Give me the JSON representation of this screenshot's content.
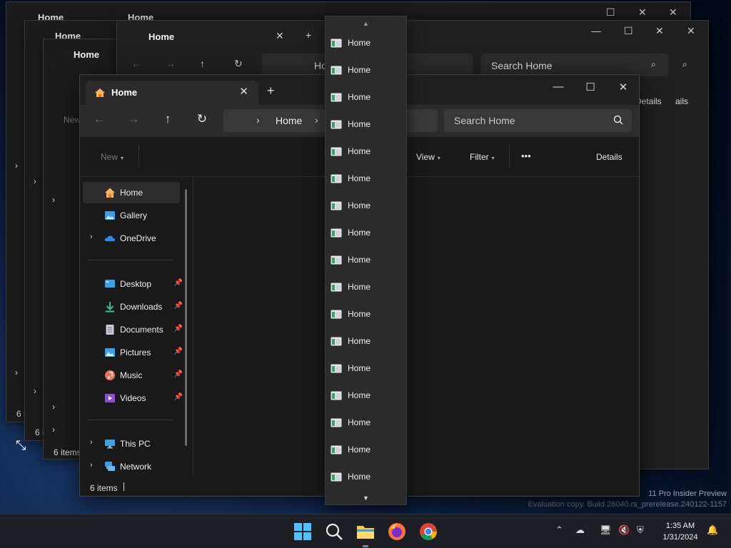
{
  "window": {
    "tab_title": "Home",
    "new_tab": "+",
    "controls": {
      "minimize": "—",
      "maximize": "☐",
      "close": "✕"
    }
  },
  "address": {
    "crumb": "Home",
    "search_placeholder": "Search Home"
  },
  "toolbar": {
    "new": "New",
    "view": "View",
    "filter": "Filter",
    "more": "•••",
    "details": "Details"
  },
  "sidebar": {
    "top": [
      {
        "label": "Home",
        "icon": "home-icon",
        "selected": true
      },
      {
        "label": "Gallery",
        "icon": "gallery-icon"
      },
      {
        "label": "OneDrive",
        "icon": "onedrive-icon",
        "expandable": true
      }
    ],
    "quick_access": [
      {
        "label": "Desktop",
        "icon": "desktop-icon"
      },
      {
        "label": "Downloads",
        "icon": "downloads-icon"
      },
      {
        "label": "Documents",
        "icon": "documents-icon"
      },
      {
        "label": "Pictures",
        "icon": "pictures-icon"
      },
      {
        "label": "Music",
        "icon": "music-icon"
      },
      {
        "label": "Videos",
        "icon": "videos-icon"
      }
    ],
    "devices": [
      {
        "label": "This PC",
        "icon": "this-pc-icon"
      },
      {
        "label": "Network",
        "icon": "network-icon"
      }
    ]
  },
  "status": {
    "items": "6 items"
  },
  "dropdown": {
    "items": [
      "Home",
      "Home",
      "Home",
      "Home",
      "Home",
      "Home",
      "Home",
      "Home",
      "Home",
      "Home",
      "Home",
      "Home",
      "Home",
      "Home",
      "Home",
      "Home",
      "Home"
    ]
  },
  "ghosts": {
    "tab_title": "Home",
    "addr_fragment": "Ho",
    "search": "Search Home",
    "details": "Details",
    "details_cut": "ails",
    "new_cut": "New",
    "items": "6 items",
    "items_cut": "6 i",
    "items_tiny": "6"
  },
  "watermark": {
    "line1": "11 Pro Insider Preview",
    "line2": "Evaluation copy. Build 26040.rs_prerelease.240122-1157"
  },
  "taskbar": {
    "icons": [
      "start-icon",
      "search-icon",
      "file-explorer-icon",
      "firefox-icon",
      "chrome-icon"
    ],
    "time": "1:35 AM",
    "date": "1/31/2024"
  },
  "colors": {
    "accent": "#4cc2ff",
    "window_bg": "#191919",
    "folder": "#f5c84c"
  }
}
